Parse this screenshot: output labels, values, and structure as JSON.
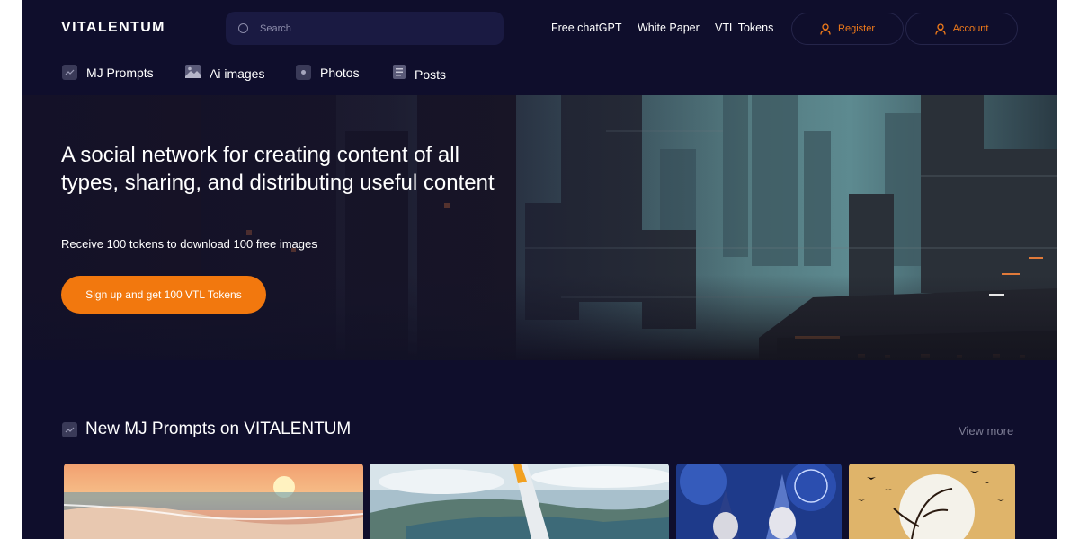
{
  "header": {
    "logo": "VITALENTUM",
    "search": {
      "placeholder": "Search"
    },
    "links": [
      {
        "label": "Free chatGPT"
      },
      {
        "label": "White Paper"
      },
      {
        "label": "VTL Tokens"
      }
    ],
    "register_label": "Register",
    "account_label": "Account"
  },
  "subnav": [
    {
      "label": "MJ Prompts",
      "icon": "trend-icon"
    },
    {
      "label": "Ai images",
      "icon": "image-icon"
    },
    {
      "label": "Photos",
      "icon": "camera-icon"
    },
    {
      "label": "Posts",
      "icon": "document-icon"
    }
  ],
  "hero": {
    "title": "A social network for creating content of all types, sharing, and distributing useful content",
    "subtitle": "Receive 100 tokens to download 100 free images",
    "cta_label": "Sign up and get 100 VTL Tokens"
  },
  "section": {
    "title": "New MJ Prompts on VITALENTUM",
    "icon": "trend-icon",
    "view_more": "View more",
    "cards": [
      {
        "subject": "sunset beach"
      },
      {
        "subject": "airplane wing over coastline"
      },
      {
        "subject": "wizards"
      },
      {
        "subject": "full moon with birds"
      }
    ]
  },
  "colors": {
    "background": "#0f0e2c",
    "accent": "#f2780e",
    "search_bg": "#1a1a42"
  }
}
